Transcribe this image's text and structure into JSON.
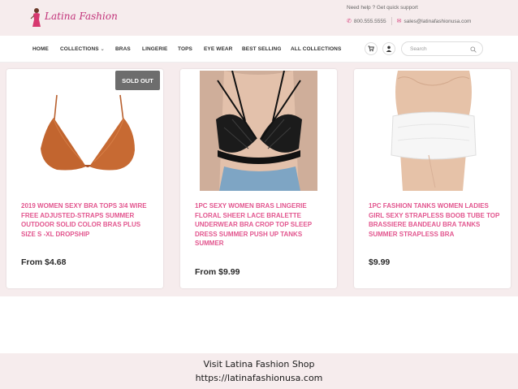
{
  "header": {
    "brand": "Latina Fashion",
    "help_text": "Need help ? Get quick support",
    "phone": "800.555.5555",
    "email": "sales@latinafashionusa.com"
  },
  "nav": {
    "items": [
      "HOME",
      "COLLECTIONS",
      "BRAS",
      "LINGERIE",
      "TOPS",
      "EYE WEAR",
      "BEST SELLING",
      "ALL COLLECTIONS"
    ],
    "search_placeholder": "Search"
  },
  "products": [
    {
      "title": "2019 WOMEN SEXY BRA TOPS 3/4 WIRE FREE ADJUSTED-STRAPS SUMMER OUTDOOR SOLID COLOR BRAS PLUS SIZE S -XL DROPSHIP",
      "price": "From $4.68",
      "badge": "SOLD OUT",
      "image": "orange-triangle-bra"
    },
    {
      "title": "1PC SEXY WOMEN BRAS LINGERIE FLORAL SHEER LACE BRALETTE UNDERWEAR BRA CROP TOP SLEEP DRESS SUMMER PUSH UP TANKS SUMMER",
      "price": "From $9.99",
      "image": "black-lace-bralette"
    },
    {
      "title": "1PC FASHION TANKS WOMEN LADIES GIRL SEXY STRAPLESS BOOB TUBE TOP BRASSIERE BANDEAU BRA TANKS SUMMER STRAPLESS BRA",
      "price": "$9.99",
      "image": "white-bandeau-bra"
    }
  ],
  "caption": {
    "line1": "Visit Latina Fashion Shop",
    "line2": "https://latinafashionusa.com"
  },
  "colors": {
    "accent": "#e2558e",
    "band_bg": "#f6eced",
    "badge_bg": "#6d6d6d"
  }
}
